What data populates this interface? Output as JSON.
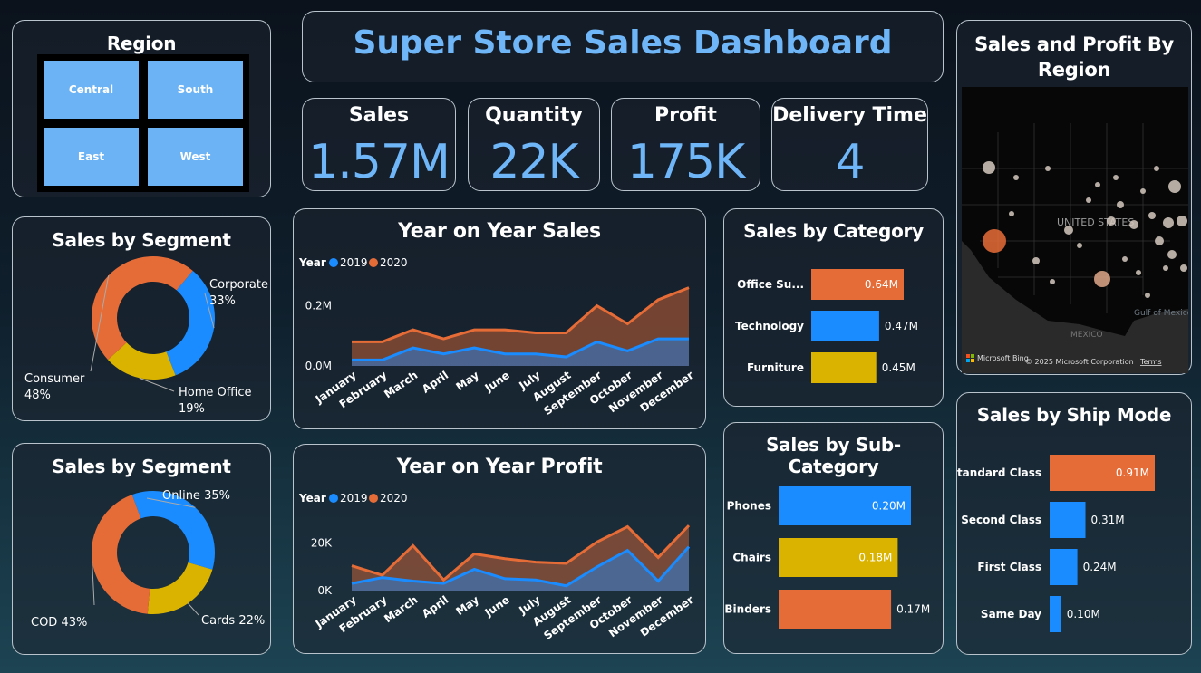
{
  "dashboard": {
    "title": "Super Store Sales Dashboard"
  },
  "region": {
    "title": "Region",
    "buttons": [
      "Central",
      "South",
      "East",
      "West"
    ]
  },
  "kpis": [
    {
      "label": "Sales",
      "value": "1.57M"
    },
    {
      "label": "Quantity",
      "value": "22K"
    },
    {
      "label": "Profit",
      "value": "175K"
    },
    {
      "label": "Delivery Time",
      "value": "4"
    }
  ],
  "colors": {
    "blue": "#1a8cff",
    "orange": "#e66c37",
    "yellow": "#d9b300",
    "kpi": "#6fb6f8"
  },
  "map": {
    "title": "Sales and Profit By Region",
    "labels": {
      "country": "UNITED STATES",
      "gulf": "Gulf of Mexico",
      "mexico": "MEXICO"
    },
    "footer": {
      "brand": "Microsoft Bing",
      "copyright": "© 2025 Microsoft Corporation",
      "terms": "Terms"
    }
  },
  "chart_data": [
    {
      "id": "segment",
      "type": "pie",
      "title": "Sales by Segment",
      "slices": [
        {
          "label": "Corporate",
          "pct": "33%",
          "value": 33,
          "color": "#1a8cff"
        },
        {
          "label": "Home Office",
          "pct": "19%",
          "value": 19,
          "color": "#d9b300"
        },
        {
          "label": "Consumer",
          "pct": "48%",
          "value": 48,
          "color": "#e66c37"
        }
      ]
    },
    {
      "id": "payment",
      "type": "pie",
      "title": "Sales by Segment",
      "slices": [
        {
          "label": "Online",
          "pct": "35%",
          "value": 35,
          "color": "#1a8cff"
        },
        {
          "label": "Cards",
          "pct": "22%",
          "value": 22,
          "color": "#d9b300"
        },
        {
          "label": "COD",
          "pct": "43%",
          "value": 43,
          "color": "#e66c37"
        }
      ]
    },
    {
      "id": "yoy_sales",
      "type": "area",
      "title": "Year on Year Sales",
      "legend_title": "Year",
      "categories": [
        "January",
        "February",
        "March",
        "April",
        "May",
        "June",
        "July",
        "August",
        "September",
        "October",
        "November",
        "December"
      ],
      "series": [
        {
          "name": "2019",
          "color": "#1a8cff",
          "values": [
            0.02,
            0.02,
            0.06,
            0.04,
            0.06,
            0.04,
            0.04,
            0.03,
            0.08,
            0.05,
            0.09,
            0.09
          ]
        },
        {
          "name": "2020",
          "color": "#e66c37",
          "values": [
            0.08,
            0.08,
            0.12,
            0.09,
            0.12,
            0.12,
            0.11,
            0.11,
            0.2,
            0.14,
            0.22,
            0.26
          ]
        }
      ],
      "yticks": [
        {
          "v": 0,
          "label": "0.0M"
        },
        {
          "v": 0.2,
          "label": "0.2M"
        }
      ],
      "ylim": [
        0,
        0.28
      ]
    },
    {
      "id": "yoy_profit",
      "type": "area",
      "title": "Year on Year Profit",
      "legend_title": "Year",
      "categories": [
        "January",
        "February",
        "March",
        "April",
        "May",
        "June",
        "July",
        "August",
        "September",
        "October",
        "November",
        "December"
      ],
      "series": [
        {
          "name": "2019",
          "color": "#1a8cff",
          "values": [
            3000,
            5500,
            4000,
            3000,
            9000,
            5000,
            4500,
            2000,
            10000,
            17000,
            4000,
            18500
          ]
        },
        {
          "name": "2020",
          "color": "#e66c37",
          "values": [
            10500,
            6500,
            19000,
            4500,
            15500,
            13500,
            12000,
            11500,
            20500,
            27000,
            14000,
            27500
          ]
        }
      ],
      "yticks": [
        {
          "v": 0,
          "label": "0K"
        },
        {
          "v": 20000,
          "label": "20K"
        }
      ],
      "ylim": [
        0,
        31000
      ]
    },
    {
      "id": "category",
      "type": "bar",
      "title": "Sales by Category",
      "categories": [
        "Office Su...",
        "Technology",
        "Furniture"
      ],
      "values": [
        0.64,
        0.47,
        0.45
      ],
      "labels": [
        "0.64M",
        "0.47M",
        "0.45M"
      ],
      "colors": [
        "#e66c37",
        "#1a8cff",
        "#d9b300"
      ],
      "xmax": 0.64
    },
    {
      "id": "subcategory",
      "type": "bar",
      "title": "Sales by Sub-Category",
      "categories": [
        "Phones",
        "Chairs",
        "Binders"
      ],
      "values": [
        0.2,
        0.18,
        0.17
      ],
      "labels": [
        "0.20M",
        "0.18M",
        "0.17M"
      ],
      "colors": [
        "#1a8cff",
        "#d9b300",
        "#e66c37"
      ],
      "xmax": 0.2
    },
    {
      "id": "shipmode",
      "type": "bar",
      "title": "Sales by Ship Mode",
      "categories": [
        "Standard Class",
        "Second Class",
        "First Class",
        "Same Day"
      ],
      "values": [
        0.91,
        0.31,
        0.24,
        0.1
      ],
      "labels": [
        "0.91M",
        "0.31M",
        "0.24M",
        "0.10M"
      ],
      "colors": [
        "#e66c37",
        "#1a8cff",
        "#1a8cff",
        "#1a8cff"
      ],
      "xmax": 0.91
    }
  ]
}
